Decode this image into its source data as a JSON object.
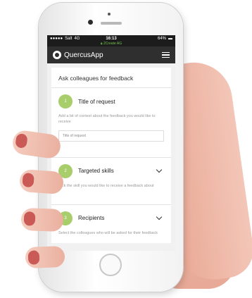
{
  "status_bar": {
    "carrier": "Salt",
    "network": "4G",
    "time": "16:13",
    "url": "2Create AG",
    "battery": "64%"
  },
  "app": {
    "name": "QuercusApp"
  },
  "page": {
    "title": "Ask colleagues for feedback"
  },
  "steps": [
    {
      "number": "1",
      "title": "Title of request",
      "description": "Add a bit of context about the feedback you would like to receive",
      "input_placeholder": "Title of request"
    },
    {
      "number": "2",
      "title": "Targeted skills",
      "description": "Pick the skill you would like to receive a feedback about"
    },
    {
      "number": "3",
      "title": "Recipients",
      "description": "Select the colleagues who will be asked for their feedback"
    }
  ],
  "colors": {
    "accent_green": "#a8cd6b",
    "header_bg": "#2f2f2f",
    "url_green": "#6cc24a"
  }
}
